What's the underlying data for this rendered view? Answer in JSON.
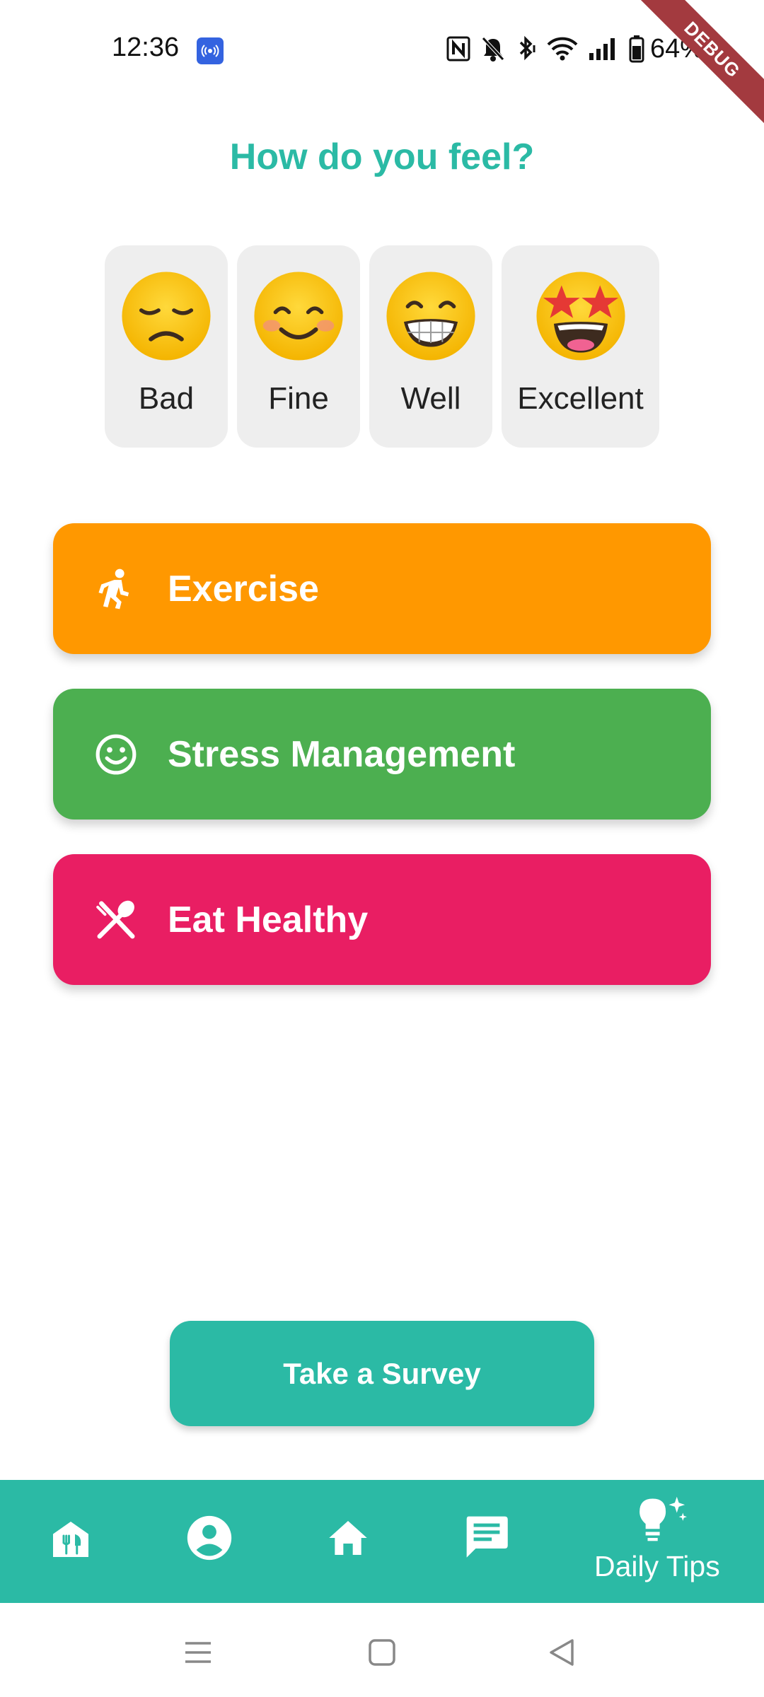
{
  "status_bar": {
    "time": "12:36",
    "battery": "64%"
  },
  "debug_banner": "DEBUG",
  "page": {
    "title": "How do you feel?"
  },
  "moods": [
    {
      "label": "Bad",
      "emoji": "disappointed-face-icon"
    },
    {
      "label": "Fine",
      "emoji": "smiling-face-icon"
    },
    {
      "label": "Well",
      "emoji": "grinning-face-icon"
    },
    {
      "label": "Excellent",
      "emoji": "star-struck-icon"
    }
  ],
  "categories": [
    {
      "label": "Exercise",
      "icon": "running-icon",
      "color": "#ff9800"
    },
    {
      "label": "Stress Management",
      "icon": "smiley-icon",
      "color": "#4caf50"
    },
    {
      "label": "Eat Healthy",
      "icon": "fork-spoon-icon",
      "color": "#e91e63"
    }
  ],
  "survey": {
    "label": "Take a Survey"
  },
  "bottom_nav": {
    "items": [
      "restaurant-home-icon",
      "account-icon",
      "home-icon",
      "chat-icon",
      "daily-tips-icon"
    ],
    "daily_tips_label": "Daily Tips"
  },
  "colors": {
    "accent": "#2bbaa5",
    "debug": "#a33a3f",
    "mood_card": "#eeeeee"
  }
}
